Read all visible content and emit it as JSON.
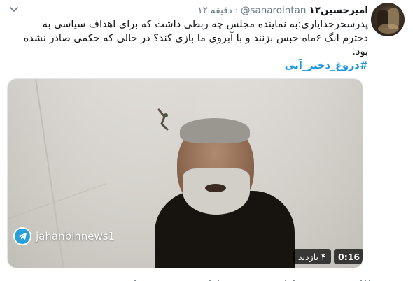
{
  "tweet": {
    "display_name": "امیرحسین۱۲",
    "handle": "@sanarointan",
    "separator": "·",
    "time": "۱۲ دقیقه",
    "text": "پدرسحرخدایاری:به نماینده مجلس چه ربطی داشت که برای اهداف سیاسی به دخترم انگ ۶ماه حبس بزنند و با آبروی ما بازی کند؟ در حالی که حکمی صادر نشده بود.",
    "hashtag": "#دروغ_دختر_آبی"
  },
  "media": {
    "watermark": "jahanbinnews1",
    "views": "۴ بازدید",
    "duration": "0:16"
  },
  "icons": {
    "menu": "chevron-down-icon",
    "watermark": "telegram-icon",
    "actions": [
      "reply-icon",
      "retweet-icon",
      "like-icon",
      "share-icon"
    ]
  },
  "colors": {
    "link": "#1b95e0",
    "secondary_text": "#657786",
    "primary_text": "#14171a"
  }
}
